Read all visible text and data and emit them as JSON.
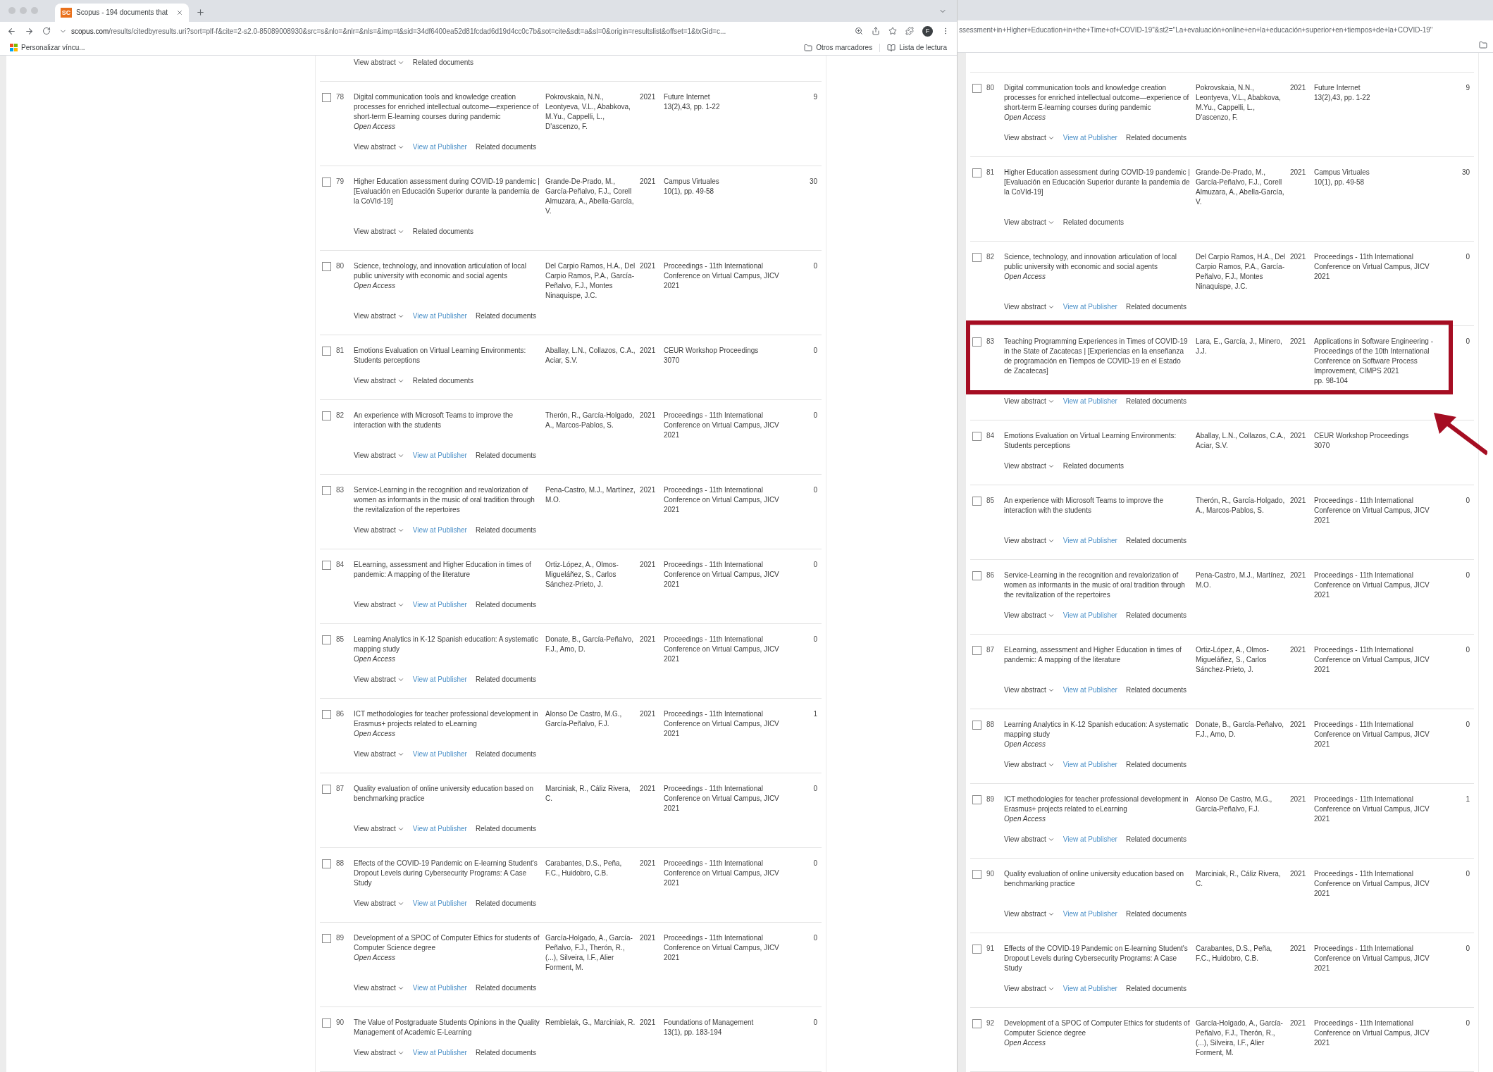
{
  "left_window": {
    "tab": {
      "icon_text": "SC",
      "title": "Scopus - 194 documents that",
      "selected": true
    },
    "address": {
      "host": "scopus.com",
      "path": "/results/citedbyresults.uri?sort=plf-f&cite=2-s2.0-85089008930&src=s&nlo=&nlr=&nls=&imp=t&sid=34df6400ea52d81fcdad6d19d4cc0c7b&sot=cite&sdt=a&sl=0&origin=resultslist&offset=1&txGid=c..."
    },
    "profile_initial": "F",
    "bookmarks": [
      {
        "label": "Personalizar víncu...",
        "kind": "apps"
      },
      {
        "label": "Otros marcadores",
        "kind": "folder"
      },
      {
        "label": "Lista de lectura",
        "kind": "reading"
      }
    ],
    "top_actions": [
      {
        "label": "View abstract",
        "kind": "abstract"
      },
      {
        "label": "Related documents",
        "kind": "related"
      }
    ],
    "rows": [
      {
        "number": "78",
        "checked": false,
        "title": "Digital communication tools and knowledge creation processes for enriched intellectual outcome—experience of short-term E-learning courses during pandemic",
        "access": "Open Access",
        "authors": "Pokrovskaia, N.N., Leontyeva, V.L., Ababkova, M.Yu., Cappelli, L., D'ascenzo, F.",
        "year": "2021",
        "source": "Future Internet",
        "source_detail": "13(2),43, pp. 1-22",
        "cites": "9",
        "actions": [
          {
            "label": "View abstract",
            "kind": "abstract"
          },
          {
            "label": "View at Publisher",
            "kind": "publisher"
          },
          {
            "label": "Related documents",
            "kind": "related"
          }
        ]
      },
      {
        "number": "79",
        "checked": false,
        "title": "Higher Education assessment during COVID-19 pandemic | [Evaluación en Educación Superior durante la pandemia de la CoVId-19]",
        "authors": "Grande-De-Prado, M., García-Peñalvo, F.J., Corell Almuzara, A., Abella-García, V.",
        "year": "2021",
        "source": "Campus Virtuales",
        "source_detail": "10(1), pp. 49-58",
        "cites": "30",
        "actions": [
          {
            "label": "View abstract",
            "kind": "abstract"
          },
          {
            "label": "Related documents",
            "kind": "related"
          }
        ]
      },
      {
        "number": "80",
        "checked": false,
        "title": "Science, technology, and innovation articulation of local public university with economic and social agents",
        "access": "Open Access",
        "authors": "Del Carpio Ramos, H.A., Del Carpio Ramos, P.A., García-Peñalvo, F.J., Montes Ninaquispe, J.C.",
        "year": "2021",
        "source": "Proceedings - 11th International Conference on Virtual Campus, JICV 2021",
        "cites": "0",
        "actions": [
          {
            "label": "View abstract",
            "kind": "abstract"
          },
          {
            "label": "View at Publisher",
            "kind": "publisher"
          },
          {
            "label": "Related documents",
            "kind": "related"
          }
        ]
      },
      {
        "number": "81",
        "checked": false,
        "title": "Emotions Evaluation on Virtual Learning Environments: Students perceptions",
        "authors": "Aballay, L.N., Collazos, C.A., Aciar, S.V.",
        "year": "2021",
        "source": "CEUR Workshop Proceedings",
        "source_detail": "3070",
        "cites": "0",
        "actions": [
          {
            "label": "View abstract",
            "kind": "abstract"
          },
          {
            "label": "Related documents",
            "kind": "related"
          }
        ]
      },
      {
        "number": "82",
        "checked": false,
        "title": "An experience with Microsoft Teams to improve the interaction with the students",
        "authors": "Therón, R., García-Holgado, A., Marcos-Pablos, S.",
        "year": "2021",
        "source": "Proceedings - 11th International Conference on Virtual Campus, JICV 2021",
        "cites": "0",
        "actions": [
          {
            "label": "View abstract",
            "kind": "abstract"
          },
          {
            "label": "View at Publisher",
            "kind": "publisher"
          },
          {
            "label": "Related documents",
            "kind": "related"
          }
        ]
      },
      {
        "number": "83",
        "checked": false,
        "title": "Service-Learning in the recognition and revalorization of women as informants in the music of oral tradition through the revitalization of the repertoires",
        "authors": "Pena-Castro, M.J., Martínez, M.O.",
        "year": "2021",
        "source": "Proceedings - 11th International Conference on Virtual Campus, JICV 2021",
        "cites": "0",
        "actions": [
          {
            "label": "View abstract",
            "kind": "abstract"
          },
          {
            "label": "View at Publisher",
            "kind": "publisher"
          },
          {
            "label": "Related documents",
            "kind": "related"
          }
        ]
      },
      {
        "number": "84",
        "checked": false,
        "title": "ELearning, assessment and Higher Education in times of pandemic: A mapping of the literature",
        "authors": "Ortiz-López, A., Olmos-Migueláñez, S., Carlos Sánchez-Prieto, J.",
        "year": "2021",
        "source": "Proceedings - 11th International Conference on Virtual Campus, JICV 2021",
        "cites": "0",
        "actions": [
          {
            "label": "View abstract",
            "kind": "abstract"
          },
          {
            "label": "View at Publisher",
            "kind": "publisher"
          },
          {
            "label": "Related documents",
            "kind": "related"
          }
        ]
      },
      {
        "number": "85",
        "checked": false,
        "title": "Learning Analytics in K-12 Spanish education: A systematic mapping study",
        "access": "Open Access",
        "authors": "Donate, B., García-Peñalvo, F.J., Amo, D.",
        "year": "2021",
        "source": "Proceedings - 11th International Conference on Virtual Campus, JICV 2021",
        "cites": "0",
        "actions": [
          {
            "label": "View abstract",
            "kind": "abstract"
          },
          {
            "label": "View at Publisher",
            "kind": "publisher"
          },
          {
            "label": "Related documents",
            "kind": "related"
          }
        ]
      },
      {
        "number": "86",
        "checked": false,
        "title": "ICT methodologies for teacher professional development in Erasmus+ projects related to eLearning",
        "access": "Open Access",
        "authors": "Alonso De Castro, M.G., García-Peñalvo, F.J.",
        "year": "2021",
        "source": "Proceedings - 11th International Conference on Virtual Campus, JICV 2021",
        "cites": "1",
        "actions": [
          {
            "label": "View abstract",
            "kind": "abstract"
          },
          {
            "label": "View at Publisher",
            "kind": "publisher"
          },
          {
            "label": "Related documents",
            "kind": "related"
          }
        ]
      },
      {
        "number": "87",
        "checked": false,
        "title": "Quality evaluation of online university education based on benchmarking practice",
        "authors": "Marciniak, R., Cáliz Rivera, C.",
        "year": "2021",
        "source": "Proceedings - 11th International Conference on Virtual Campus, JICV 2021",
        "cites": "0",
        "actions": [
          {
            "label": "View abstract",
            "kind": "abstract"
          },
          {
            "label": "View at Publisher",
            "kind": "publisher"
          },
          {
            "label": "Related documents",
            "kind": "related"
          }
        ]
      },
      {
        "number": "88",
        "checked": false,
        "title": "Effects of the COVID-19 Pandemic on E-learning Student's Dropout Levels during Cybersecurity Programs: A Case Study",
        "authors": "Carabantes, D.S., Peña, F.C., Huidobro, C.B.",
        "year": "2021",
        "source": "Proceedings - 11th International Conference on Virtual Campus, JICV 2021",
        "cites": "0",
        "actions": [
          {
            "label": "View abstract",
            "kind": "abstract"
          },
          {
            "label": "View at Publisher",
            "kind": "publisher"
          },
          {
            "label": "Related documents",
            "kind": "related"
          }
        ]
      },
      {
        "number": "89",
        "checked": false,
        "title": "Development of a SPOC of Computer Ethics for students of Computer Science degree",
        "access": "Open Access",
        "authors": "García-Holgado, A., García-Peñalvo, F.J., Therón, R., (...), Silveira, I.F., Alier Forment, M.",
        "year": "2021",
        "source": "Proceedings - 11th International Conference on Virtual Campus, JICV 2021",
        "cites": "0",
        "actions": [
          {
            "label": "View abstract",
            "kind": "abstract"
          },
          {
            "label": "View at Publisher",
            "kind": "publisher"
          },
          {
            "label": "Related documents",
            "kind": "related"
          }
        ]
      },
      {
        "number": "90",
        "checked": false,
        "title": "The Value of Postgraduate Students Opinions in the Quality Management of Academic E-Learning",
        "authors": "Rembielak, G., Marciniak, R.",
        "year": "2021",
        "source": "Foundations of Management",
        "source_detail": "13(1), pp. 183-194",
        "cites": "0",
        "actions": [
          {
            "label": "View abstract",
            "kind": "abstract"
          },
          {
            "label": "View at Publisher",
            "kind": "publisher"
          },
          {
            "label": "Related documents",
            "kind": "related"
          }
        ]
      }
    ]
  },
  "right_window": {
    "address": {
      "text": "ssessment+in+Higher+Education+in+the+Time+of+COVID-19\"&st2=\"La+evaluación+online+en+la+educación+superior+en+tiempos+de+la+COVID-19\""
    },
    "rows": [
      {
        "number": "80",
        "checked": false,
        "highlighted": false,
        "title": "Digital communication tools and knowledge creation processes for enriched intellectual outcome—experience of short-term E-learning courses during pandemic",
        "access": "Open Access",
        "authors": "Pokrovskaia, N.N., Leontyeva, V.L., Ababkova, M.Yu., Cappelli, L., D'ascenzo, F.",
        "year": "2021",
        "source": "Future Internet",
        "source_detail": "13(2),43, pp. 1-22",
        "cites": "9",
        "actions": [
          {
            "label": "View abstract",
            "kind": "abstract"
          },
          {
            "label": "View at Publisher",
            "kind": "publisher"
          },
          {
            "label": "Related documents",
            "kind": "related"
          }
        ]
      },
      {
        "number": "81",
        "checked": false,
        "highlighted": false,
        "title": "Higher Education assessment during COVID-19 pandemic | [Evaluación en Educación Superior durante la pandemia de la CoVId-19]",
        "authors": "Grande-De-Prado, M., García-Peñalvo, F.J., Corell Almuzara, A., Abella-García, V.",
        "year": "2021",
        "source": "Campus Virtuales",
        "source_detail": "10(1), pp. 49-58",
        "cites": "30",
        "actions": [
          {
            "label": "View abstract",
            "kind": "abstract"
          },
          {
            "label": "Related documents",
            "kind": "related"
          }
        ]
      },
      {
        "number": "82",
        "checked": false,
        "highlighted": false,
        "title": "Science, technology, and innovation articulation of local public university with economic and social agents",
        "access": "Open Access",
        "authors": "Del Carpio Ramos, H.A., Del Carpio Ramos, P.A., García-Peñalvo, F.J., Montes Ninaquispe, J.C.",
        "year": "2021",
        "source": "Proceedings - 11th International Conference on Virtual Campus, JICV 2021",
        "cites": "0",
        "actions": [
          {
            "label": "View abstract",
            "kind": "abstract"
          },
          {
            "label": "View at Publisher",
            "kind": "publisher"
          },
          {
            "label": "Related documents",
            "kind": "related"
          }
        ]
      },
      {
        "number": "83",
        "checked": false,
        "highlighted": true,
        "title": "Teaching Programming Experiences in Times of COVID-19 in the State of Zacatecas | [Experiencias en la enseñanza de programación en Tiempos de COVID-19 en el Estado de Zacatecas]",
        "authors": "Lara, E., García, J., Minero, J.J.",
        "year": "2021",
        "source": "Applications in Software Engineering - Proceedings of the 10th International Conference on Software Process Improvement, CIMPS 2021",
        "source_detail": "pp. 98-104",
        "cites": "0",
        "actions": [
          {
            "label": "View abstract",
            "kind": "abstract"
          },
          {
            "label": "View at Publisher",
            "kind": "publisher"
          },
          {
            "label": "Related documents",
            "kind": "related"
          }
        ]
      },
      {
        "number": "84",
        "checked": false,
        "highlighted": false,
        "title": "Emotions Evaluation on Virtual Learning Environments: Students perceptions",
        "authors": "Aballay, L.N., Collazos, C.A., Aciar, S.V.",
        "year": "2021",
        "source": "CEUR Workshop Proceedings",
        "source_detail": "3070",
        "actions": [
          {
            "label": "View abstract",
            "kind": "abstract"
          },
          {
            "label": "Related documents",
            "kind": "related"
          }
        ]
      },
      {
        "number": "85",
        "checked": false,
        "highlighted": false,
        "title": "An experience with Microsoft Teams to improve the interaction with the students",
        "authors": "Therón, R., García-Holgado, A., Marcos-Pablos, S.",
        "year": "2021",
        "source": "Proceedings - 11th International Conference on Virtual Campus, JICV 2021",
        "cites": "0",
        "actions": [
          {
            "label": "View abstract",
            "kind": "abstract"
          },
          {
            "label": "View at Publisher",
            "kind": "publisher"
          },
          {
            "label": "Related documents",
            "kind": "related"
          }
        ]
      },
      {
        "number": "86",
        "checked": false,
        "highlighted": false,
        "title": "Service-Learning in the recognition and revalorization of women as informants in the music of oral tradition through the revitalization of the repertoires",
        "authors": "Pena-Castro, M.J., Martínez, M.O.",
        "year": "2021",
        "source": "Proceedings - 11th International Conference on Virtual Campus, JICV 2021",
        "cites": "0",
        "actions": [
          {
            "label": "View abstract",
            "kind": "abstract"
          },
          {
            "label": "View at Publisher",
            "kind": "publisher"
          },
          {
            "label": "Related documents",
            "kind": "related"
          }
        ]
      },
      {
        "number": "87",
        "checked": false,
        "highlighted": false,
        "title": "ELearning, assessment and Higher Education in times of pandemic: A mapping of the literature",
        "authors": "Ortiz-López, A., Olmos-Migueláñez, S., Carlos Sánchez-Prieto, J.",
        "year": "2021",
        "source": "Proceedings - 11th International Conference on Virtual Campus, JICV 2021",
        "cites": "0",
        "actions": [
          {
            "label": "View abstract",
            "kind": "abstract"
          },
          {
            "label": "View at Publisher",
            "kind": "publisher"
          },
          {
            "label": "Related documents",
            "kind": "related"
          }
        ]
      },
      {
        "number": "88",
        "checked": false,
        "highlighted": false,
        "title": "Learning Analytics in K-12 Spanish education: A systematic mapping study",
        "access": "Open Access",
        "authors": "Donate, B., García-Peñalvo, F.J., Amo, D.",
        "year": "2021",
        "source": "Proceedings - 11th International Conference on Virtual Campus, JICV 2021",
        "cites": "0",
        "actions": [
          {
            "label": "View abstract",
            "kind": "abstract"
          },
          {
            "label": "View at Publisher",
            "kind": "publisher"
          },
          {
            "label": "Related documents",
            "kind": "related"
          }
        ]
      },
      {
        "number": "89",
        "checked": false,
        "highlighted": false,
        "title": "ICT methodologies for teacher professional development in Erasmus+ projects related to eLearning",
        "access": "Open Access",
        "authors": "Alonso De Castro, M.G., García-Peñalvo, F.J.",
        "year": "2021",
        "source": "Proceedings - 11th International Conference on Virtual Campus, JICV 2021",
        "cites": "1",
        "actions": [
          {
            "label": "View abstract",
            "kind": "abstract"
          },
          {
            "label": "View at Publisher",
            "kind": "publisher"
          },
          {
            "label": "Related documents",
            "kind": "related"
          }
        ]
      },
      {
        "number": "90",
        "checked": false,
        "highlighted": false,
        "title": "Quality evaluation of online university education based on benchmarking practice",
        "authors": "Marciniak, R., Cáliz Rivera, C.",
        "year": "2021",
        "source": "Proceedings - 11th International Conference on Virtual Campus, JICV 2021",
        "cites": "0",
        "actions": [
          {
            "label": "View abstract",
            "kind": "abstract"
          },
          {
            "label": "View at Publisher",
            "kind": "publisher"
          },
          {
            "label": "Related documents",
            "kind": "related"
          }
        ]
      },
      {
        "number": "91",
        "checked": false,
        "highlighted": false,
        "title": "Effects of the COVID-19 Pandemic on E-learning Student's Dropout Levels during Cybersecurity Programs: A Case Study",
        "authors": "Carabantes, D.S., Peña, F.C., Huidobro, C.B.",
        "year": "2021",
        "source": "Proceedings - 11th International Conference on Virtual Campus, JICV 2021",
        "cites": "0",
        "actions": [
          {
            "label": "View abstract",
            "kind": "abstract"
          },
          {
            "label": "View at Publisher",
            "kind": "publisher"
          },
          {
            "label": "Related documents",
            "kind": "related"
          }
        ]
      },
      {
        "number": "92",
        "checked": false,
        "highlighted": false,
        "title": "Development of a SPOC of Computer Ethics for students of Computer Science degree",
        "access": "Open Access",
        "authors": "García-Holgado, A., García-Peñalvo, F.J., Therón, R., (...), Silveira, I.F., Alier Forment, M.",
        "year": "2021",
        "source": "Proceedings - 11th International Conference on Virtual Campus, JICV 2021",
        "cites": "0",
        "actions": []
      }
    ]
  }
}
